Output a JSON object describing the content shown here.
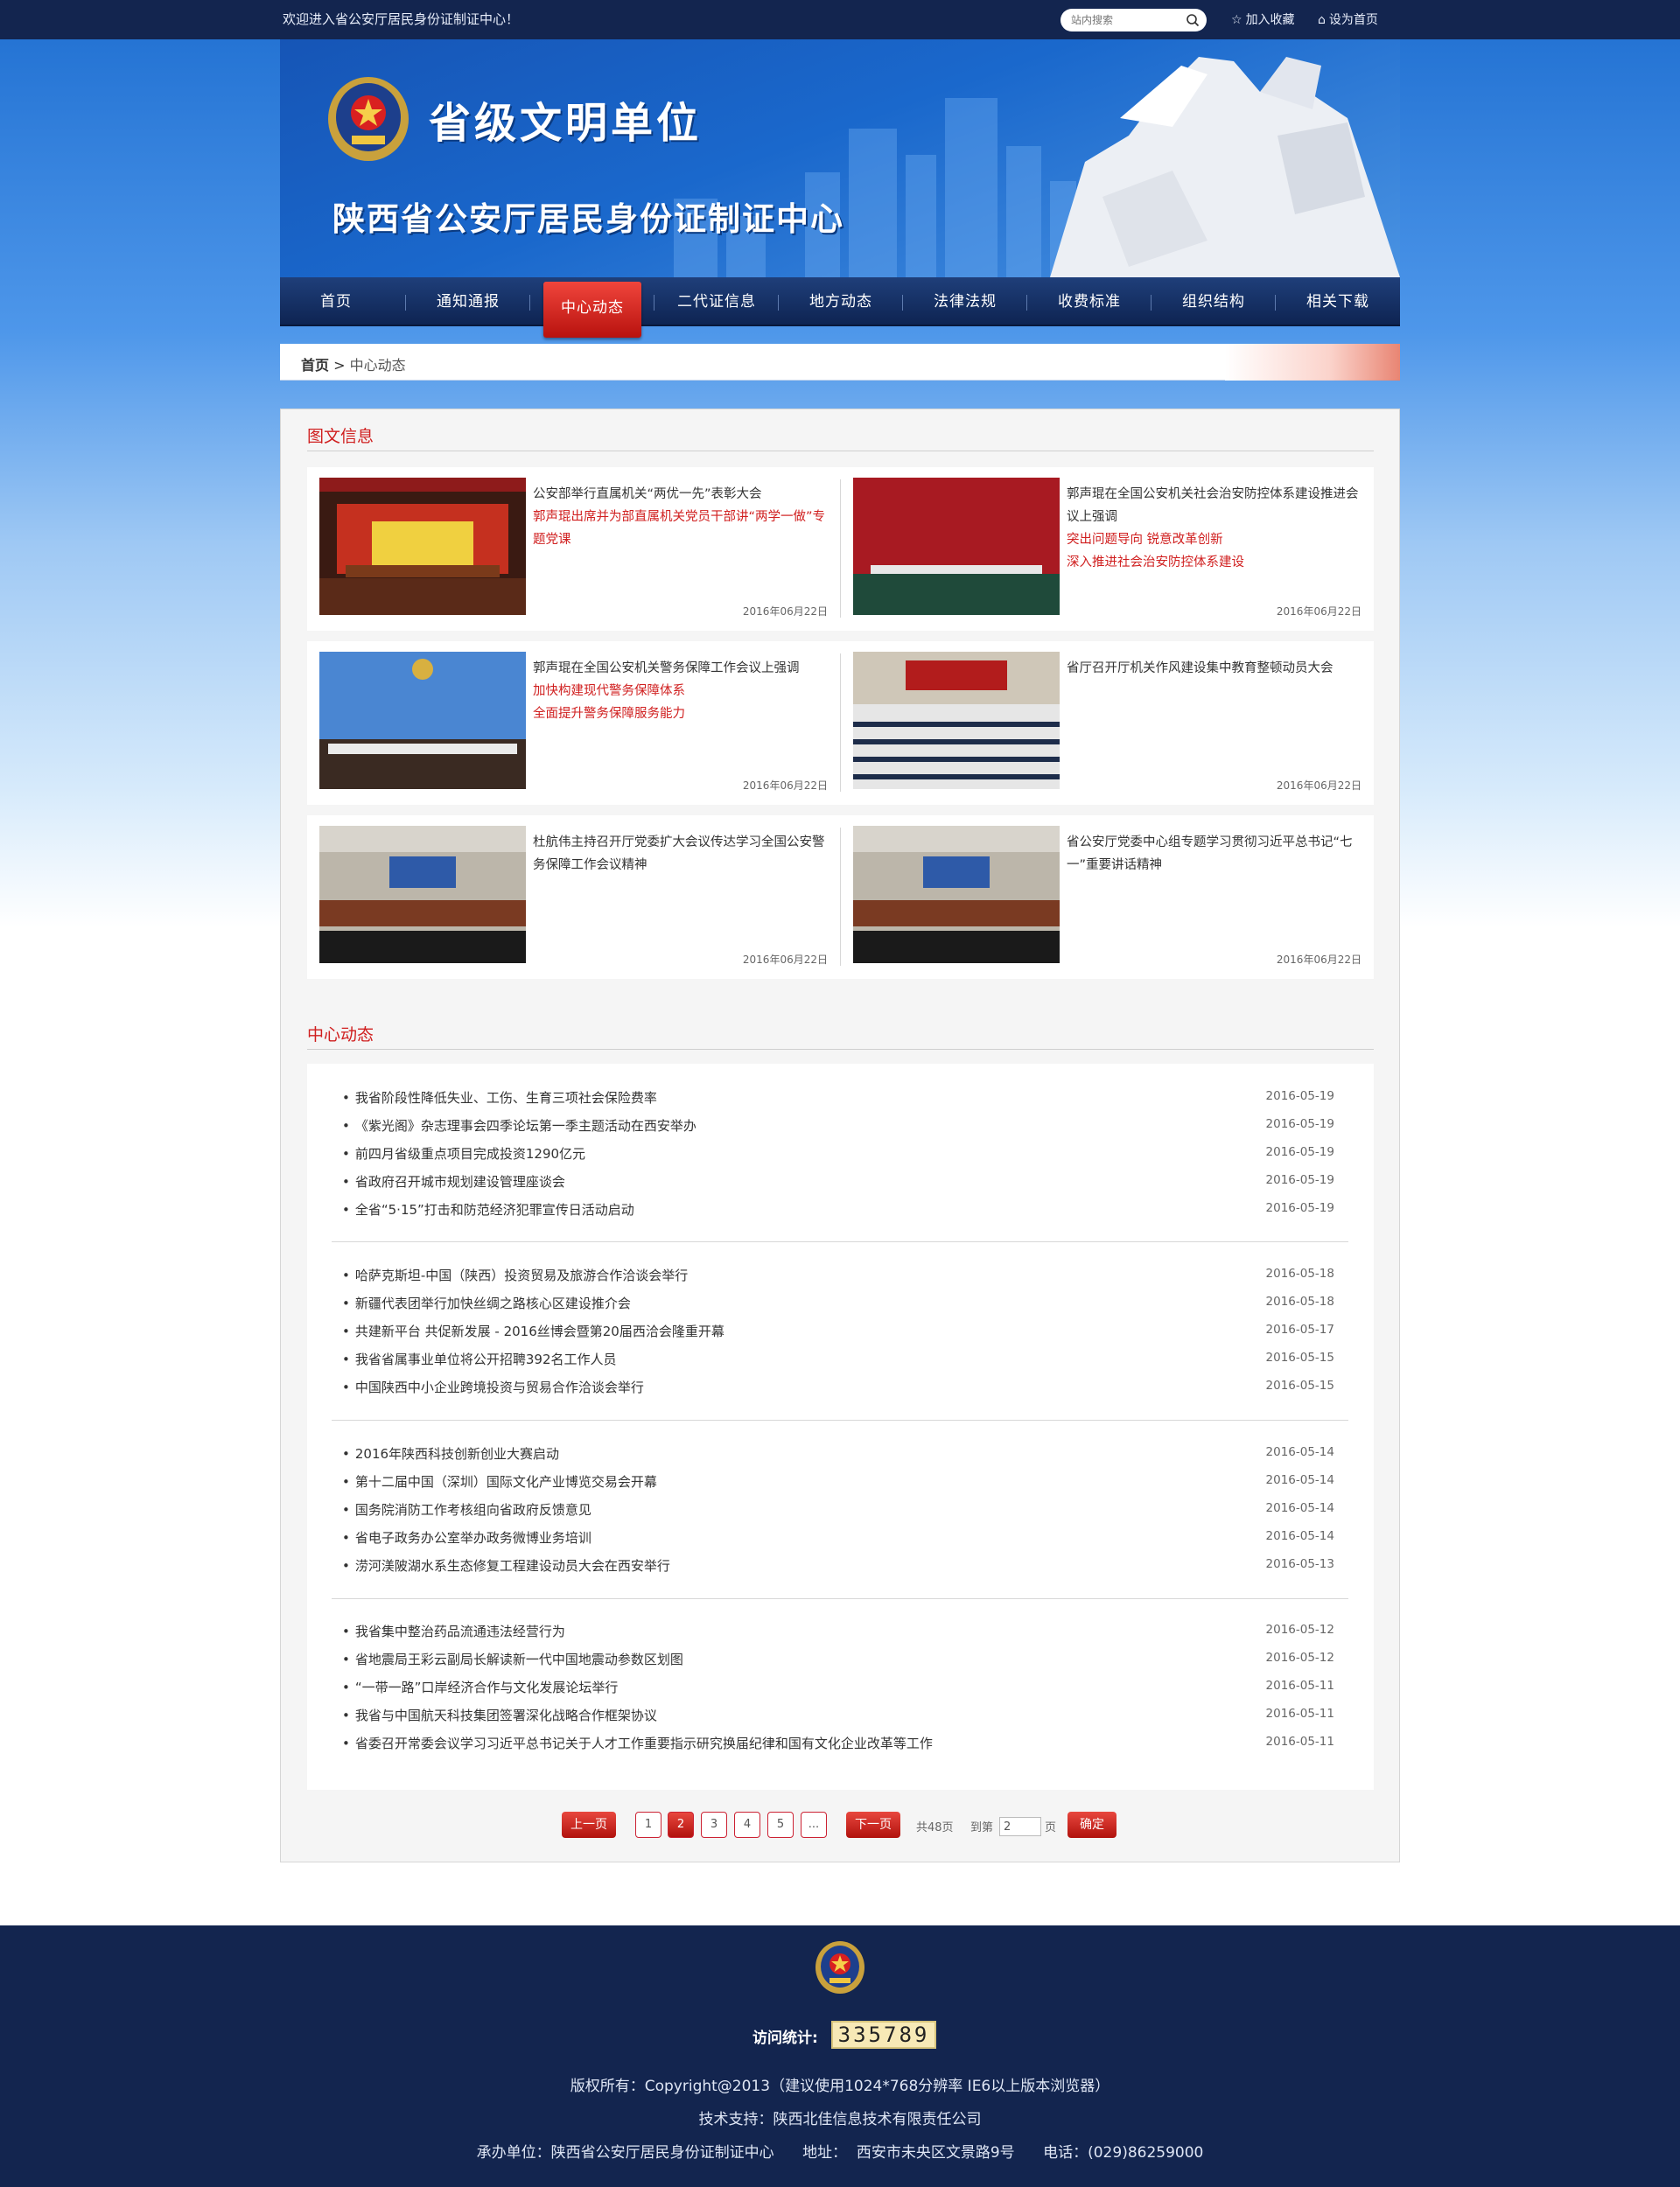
{
  "topbar": {
    "welcome": "欢迎进入省公安厅居民身份证制证中心！",
    "search_placeholder": "站内搜索",
    "bookmark": "加入收藏",
    "homepage": "设为首页"
  },
  "banner": {
    "title1": "省级文明单位",
    "title2": "陕西省公安厅居民身份证制证中心"
  },
  "nav": {
    "items": [
      "首页",
      "通知通报",
      "中心动态",
      "二代证信息",
      "地方动态",
      "法律法规",
      "收费标准",
      "组织结构",
      "相关下载"
    ],
    "active_index": 2
  },
  "breadcrumb": {
    "home": "首页",
    "sep": " > ",
    "current": "中心动态"
  },
  "photo_section": {
    "title": "图文信息",
    "items": [
      {
        "title": "公安部举行直属机关“两优一先”表彰大会",
        "sub": [
          "郭声琨出席并为部直属机关党员干部讲“两学一做”专题党课"
        ],
        "date": "2016年06月22日"
      },
      {
        "title": "郭声琨在全国公安机关社会治安防控体系建设推进会议上强调",
        "sub": [
          "突出问题导向 锐意改革创新",
          "深入推进社会治安防控体系建设"
        ],
        "date": "2016年06月22日"
      },
      {
        "title": "郭声琨在全国公安机关警务保障工作会议上强调",
        "sub": [
          "加快构建现代警务保障体系",
          "全面提升警务保障服务能力"
        ],
        "date": "2016年06月22日"
      },
      {
        "title": "省厅召开厅机关作风建设集中教育整顿动员大会",
        "sub": [],
        "date": "2016年06月22日"
      },
      {
        "title": "杜航伟主持召开厅党委扩大会议传达学习全国公安警务保障工作会议精神",
        "sub": [],
        "date": "2016年06月22日"
      },
      {
        "title": "省公安厅党委中心组专题学习贯彻习近平总书记“七一”重要讲话精神",
        "sub": [],
        "date": "2016年06月22日"
      }
    ]
  },
  "list_section": {
    "title": "中心动态",
    "groups": [
      [
        {
          "title": "我省阶段性降低失业、工伤、生育三项社会保险费率",
          "date": "2016-05-19"
        },
        {
          "title": "《紫光阁》杂志理事会四季论坛第一季主题活动在西安举办",
          "date": "2016-05-19"
        },
        {
          "title": "前四月省级重点项目完成投资1290亿元",
          "date": "2016-05-19"
        },
        {
          "title": "省政府召开城市规划建设管理座谈会",
          "date": "2016-05-19"
        },
        {
          "title": "全省“5·15”打击和防范经济犯罪宣传日活动启动",
          "date": "2016-05-19"
        }
      ],
      [
        {
          "title": "哈萨克斯坦-中国（陕西）投资贸易及旅游合作洽谈会举行",
          "date": "2016-05-18"
        },
        {
          "title": "新疆代表团举行加快丝绸之路核心区建设推介会",
          "date": "2016-05-18"
        },
        {
          "title": "共建新平台 共促新发展 - 2016丝博会暨第20届西洽会隆重开幕",
          "date": "2016-05-17"
        },
        {
          "title": "我省省属事业单位将公开招聘392名工作人员",
          "date": "2016-05-15"
        },
        {
          "title": "中国陕西中小企业跨境投资与贸易合作洽谈会举行",
          "date": "2016-05-15"
        }
      ],
      [
        {
          "title": "2016年陕西科技创新创业大赛启动",
          "date": "2016-05-14"
        },
        {
          "title": "第十二届中国（深圳）国际文化产业博览交易会开幕",
          "date": "2016-05-14"
        },
        {
          "title": "国务院消防工作考核组向省政府反馈意见",
          "date": "2016-05-14"
        },
        {
          "title": "省电子政务办公室举办政务微博业务培训",
          "date": "2016-05-14"
        },
        {
          "title": "涝河渼陂湖水系生态修复工程建设动员大会在西安举行",
          "date": "2016-05-13"
        }
      ],
      [
        {
          "title": "我省集中整治药品流通违法经营行为",
          "date": "2016-05-12"
        },
        {
          "title": "省地震局王彩云副局长解读新一代中国地震动参数区划图",
          "date": "2016-05-12"
        },
        {
          "title": "“一带一路”口岸经济合作与文化发展论坛举行",
          "date": "2016-05-11"
        },
        {
          "title": "我省与中国航天科技集团签署深化战略合作框架协议",
          "date": "2016-05-11"
        },
        {
          "title": "省委召开常委会议学习习近平总书记关于人才工作重要指示研究换届纪律和国有文化企业改革等工作",
          "date": "2016-05-11"
        }
      ]
    ]
  },
  "pagination": {
    "prev": "上一页",
    "pages": [
      "1",
      "2",
      "3",
      "4",
      "5",
      "..."
    ],
    "current_page": "2",
    "next": "下一页",
    "total": "共48页",
    "goto_prefix": "到第",
    "goto_value": "2",
    "goto_suffix": "页",
    "confirm": "确定"
  },
  "footer": {
    "visits_label": "访问统计:",
    "visits_count": "335789",
    "copyright": "版权所有：Copyright@2013（建议使用1024*768分辨率  IE6以上版本浏览器）",
    "support": "技术支持：陕西北佳信息技术有限责任公司",
    "host": "承办单位：陕西省公安厅居民身份证制证中心      地址：  西安市未央区文景路9号      电话：(029)86259000"
  },
  "colors": {
    "accent_red": "#d01f1f",
    "nav_bg": "#0e2452",
    "topbar_bg": "#13254f"
  },
  "icons": [
    "search-icon",
    "star-icon",
    "home-icon",
    "police-badge-icon"
  ]
}
